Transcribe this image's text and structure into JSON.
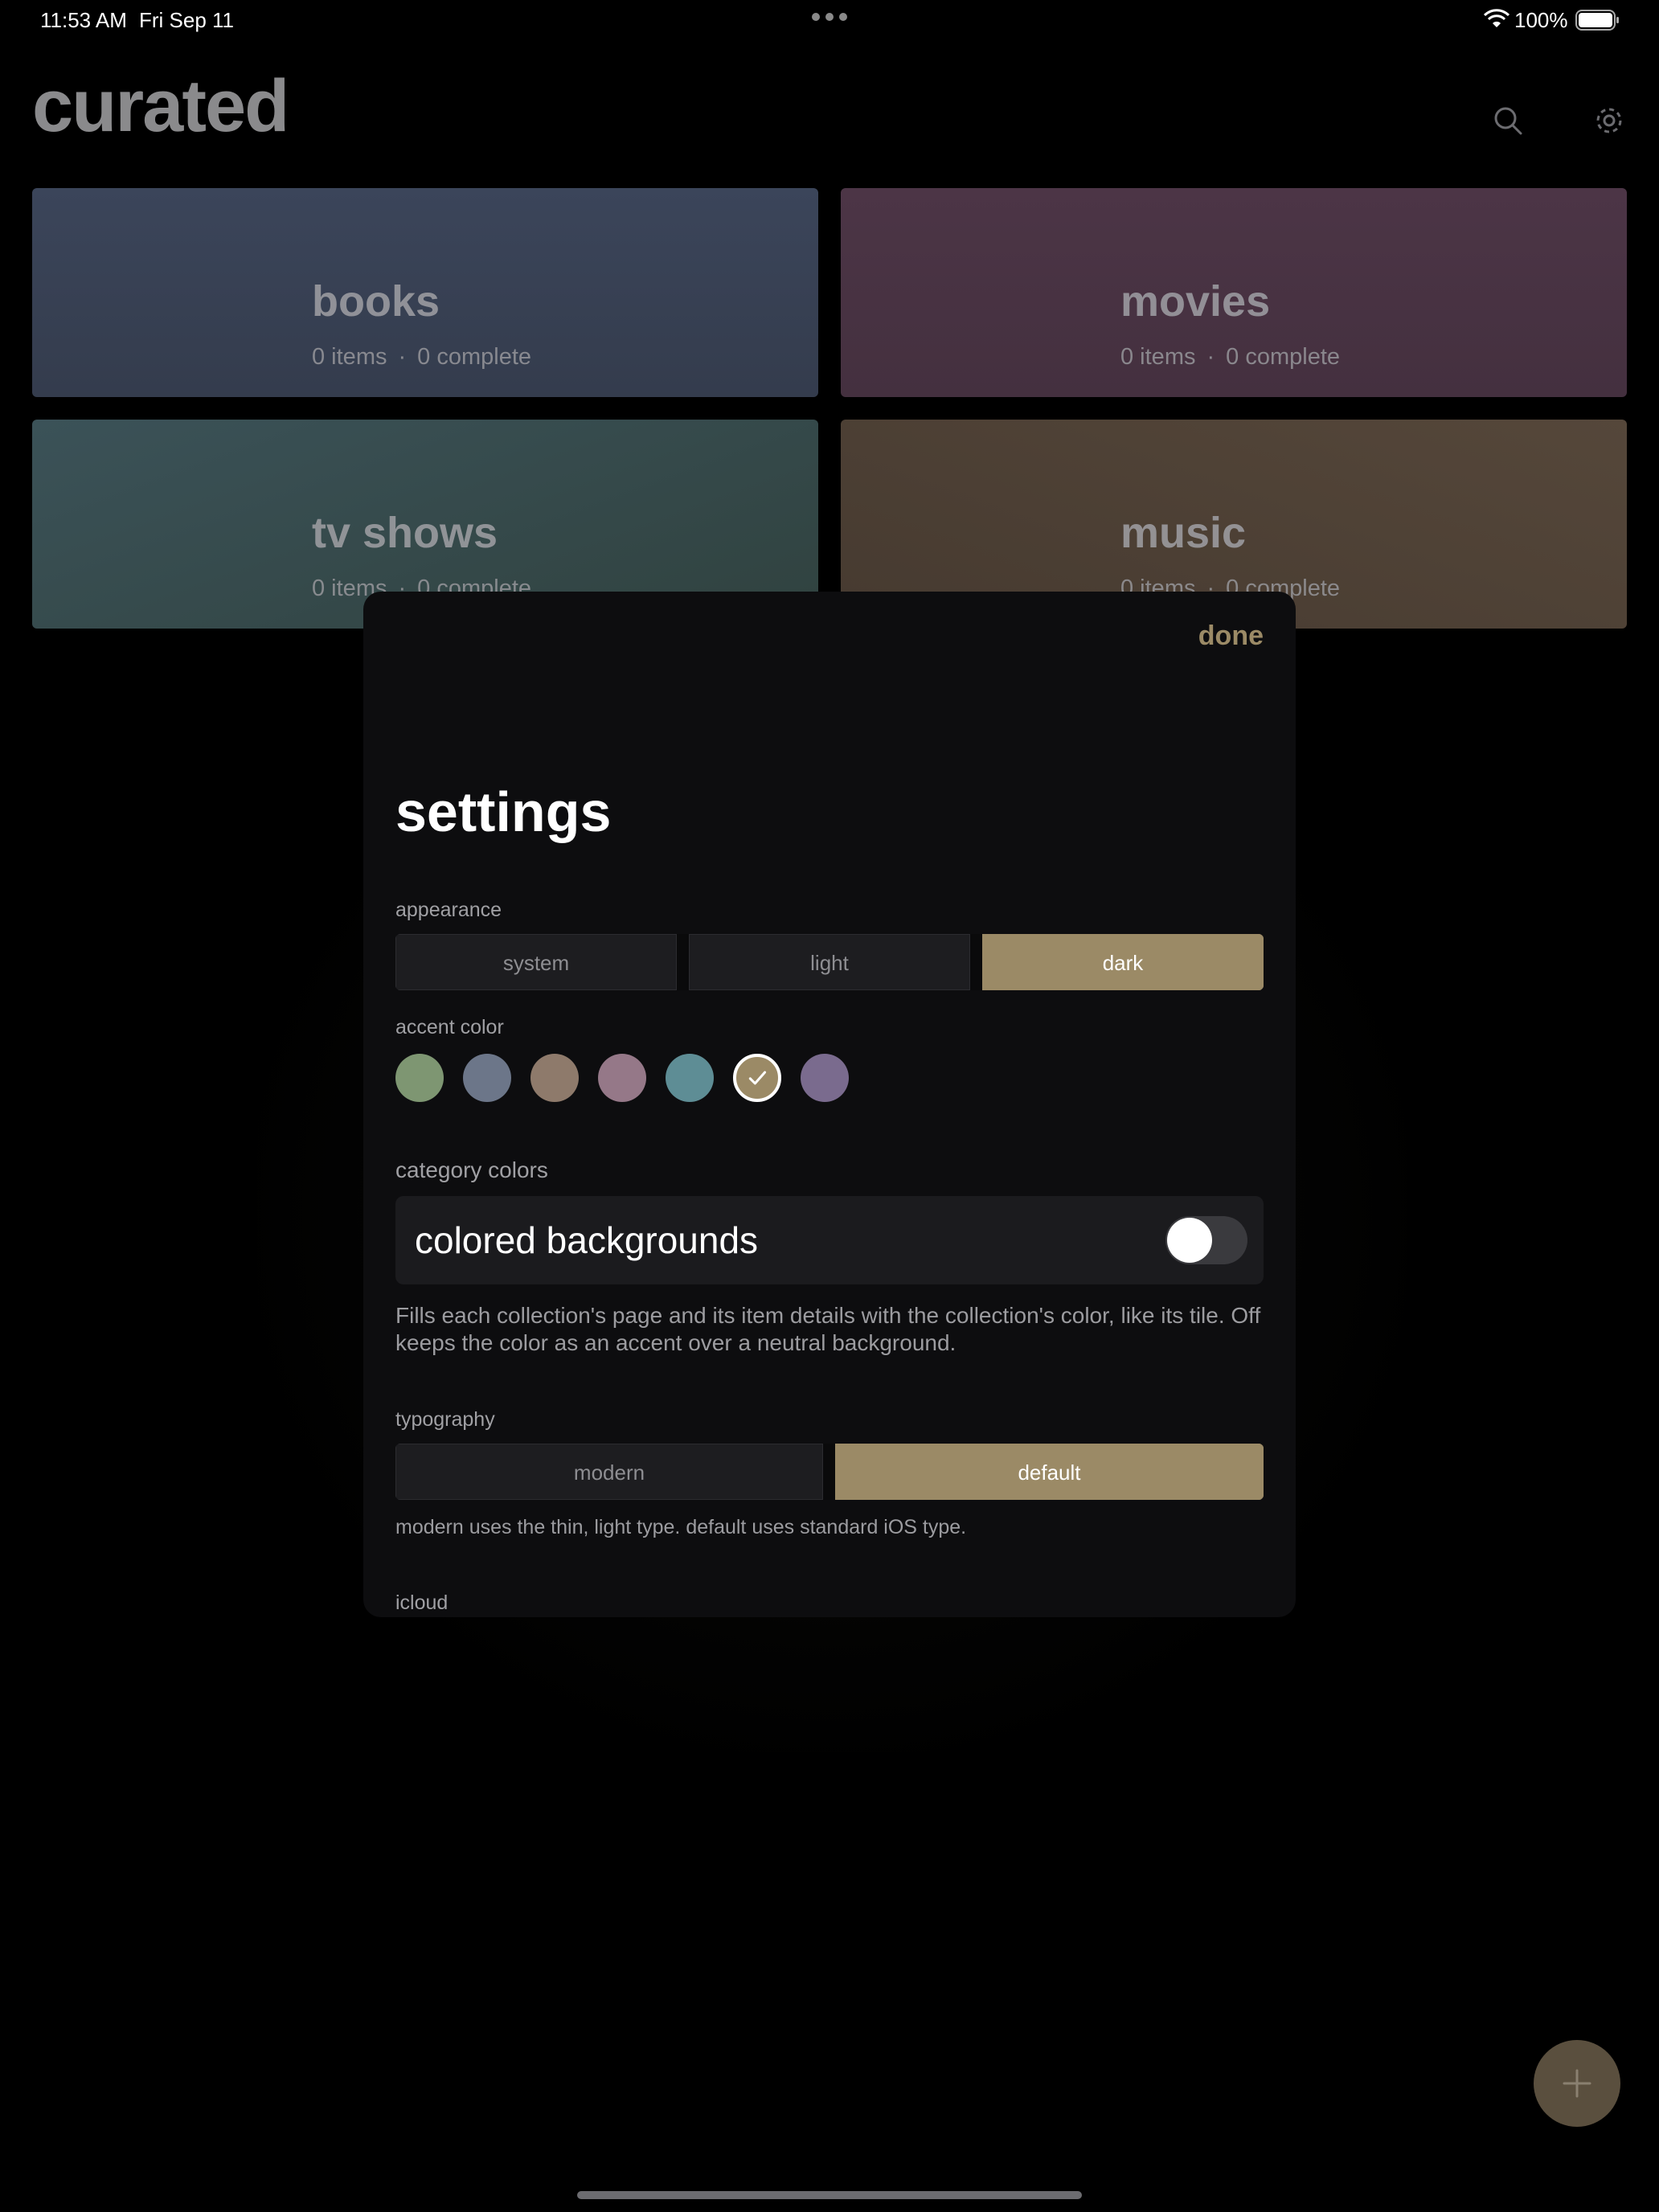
{
  "status_bar": {
    "time": "11:53 AM",
    "date": "Fri Sep 11",
    "battery_pct": "100%"
  },
  "header": {
    "title": "curated",
    "icons": [
      "search-icon",
      "gear-icon"
    ]
  },
  "collections": [
    {
      "name": "books",
      "items": "0 items",
      "separator": "·",
      "complete": "0 complete",
      "color": "#3a4356"
    },
    {
      "name": "movies",
      "items": "0 items",
      "separator": "·",
      "complete": "0 complete",
      "color": "#4a3444"
    },
    {
      "name": "tv shows",
      "items": "0 items",
      "separator": "·",
      "complete": "0 complete",
      "color": "#334a4d"
    },
    {
      "name": "music",
      "items": "0 items",
      "separator": "·",
      "complete": "0 complete",
      "color": "#4c3e34"
    }
  ],
  "settings": {
    "done_label": "done",
    "title": "settings",
    "appearance": {
      "label": "appearance",
      "options": [
        "system",
        "light",
        "dark"
      ],
      "selected": "dark"
    },
    "accent": {
      "label": "accent color",
      "colors": [
        "#7e9672",
        "#6c7689",
        "#8e7a6b",
        "#957888",
        "#5e8d95",
        "#9b8a66",
        "#7a6b8e"
      ],
      "selected_index": 5
    },
    "category_colors": {
      "label": "category colors",
      "toggle_label": "colored backgrounds",
      "toggle_on": false,
      "help": "Fills each collection's page and its item details with the collection's color, like its tile. Off keeps the color as an accent over a neutral background."
    },
    "typography": {
      "label": "typography",
      "options": [
        "modern",
        "default"
      ],
      "selected": "default",
      "help": "modern uses the thin, light type. default uses standard iOS type."
    },
    "icloud": {
      "label": "icloud"
    }
  },
  "fab_icon": "plus-icon",
  "accent_color": "#9b8a66"
}
